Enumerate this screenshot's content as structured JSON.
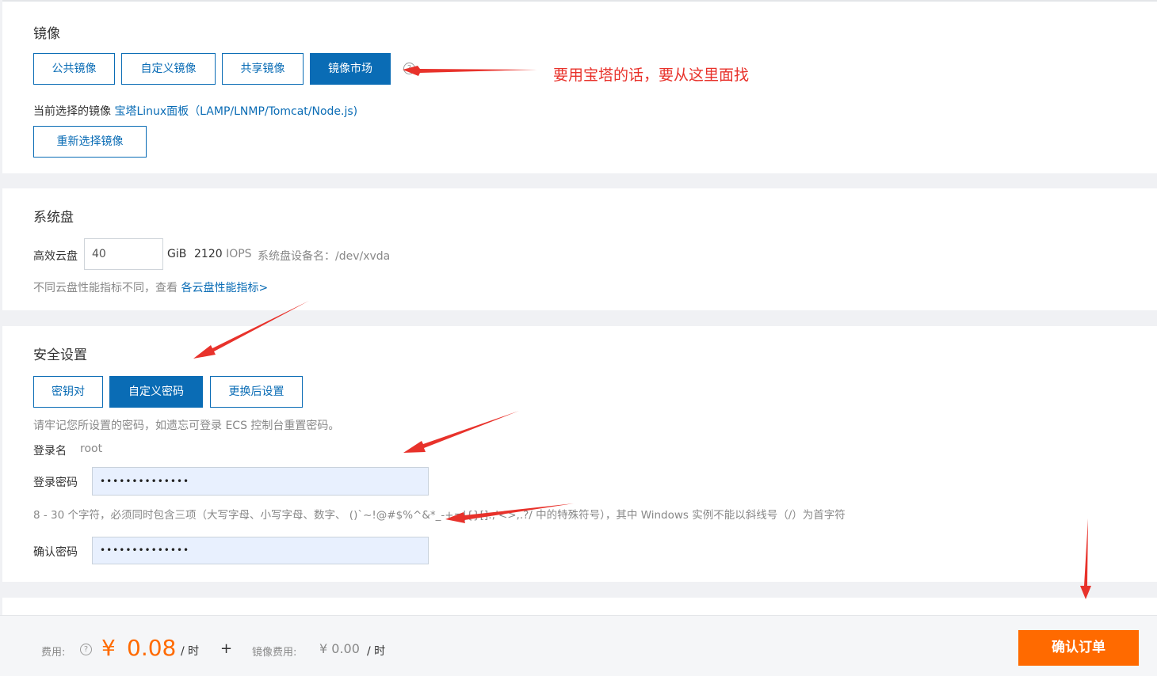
{
  "image_section": {
    "title": "镜像",
    "tabs": [
      {
        "label": "公共镜像",
        "active": false
      },
      {
        "label": "自定义镜像",
        "active": false
      },
      {
        "label": "共享镜像",
        "active": false
      },
      {
        "label": "镜像市场",
        "active": true
      }
    ],
    "current_prefix": "当前选择的镜像",
    "current_image_name": "宝塔Linux面板",
    "current_image_detail": "（LAMP/LNMP/Tomcat/Node.js)",
    "reselect_label": "重新选择镜像"
  },
  "annotation_text": "要用宝塔的话，要从这里面找",
  "system_disk": {
    "title": "系统盘",
    "type_label": "高效云盘",
    "size_value": "40",
    "unit": "GiB",
    "iops_value": "2120",
    "iops_unit": "IOPS",
    "device_label": "系统盘设备名：/dev/xvda",
    "hint_prefix": "不同云盘性能指标不同，查看",
    "hint_link": "各云盘性能指标>"
  },
  "security": {
    "title": "安全设置",
    "tabs": [
      {
        "label": "密钥对",
        "active": false
      },
      {
        "label": "自定义密码",
        "active": true
      },
      {
        "label": "更换后设置",
        "active": false
      }
    ],
    "remember_note": "请牢记您所设置的密码，如遗忘可登录 ECS 控制台重置密码。",
    "login_name_label": "登录名",
    "login_name_value": "root",
    "password_label": "登录密码",
    "password_value": "••••••••••••••",
    "password_rule": "8 - 30 个字符，必须同时包含三项（大写字母、小写字母、数字、 ()`~!@#$%^&*_-+=|{}[]:;'<>,.?/ 中的特殊符号），其中 Windows 实例不能以斜线号（/）为首字符",
    "confirm_label": "确认密码",
    "confirm_value": "••••••••••••••"
  },
  "footer": {
    "fee_label": "费用:",
    "currency": "¥",
    "price": "0.08",
    "per_hour": "/ 时",
    "plus": "+",
    "image_fee_label": "镜像费用:",
    "image_fee": "¥ 0.00",
    "image_per_hour": "/ 时",
    "confirm_button": "确认订单"
  },
  "colors": {
    "primary": "#0a6cb5",
    "accent_orange": "#ff6a00",
    "annotation_red": "#e8322b"
  }
}
